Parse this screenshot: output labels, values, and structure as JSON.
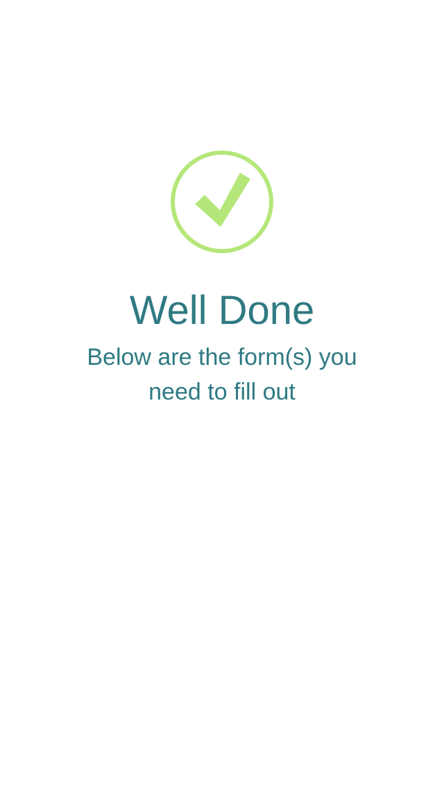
{
  "success": {
    "icon": "check-circle-icon",
    "icon_color": "#b5e67a",
    "title": "Well Done",
    "message": "Below are the form(s) you need to fill out",
    "text_color": "#2f7a82"
  },
  "forms": []
}
